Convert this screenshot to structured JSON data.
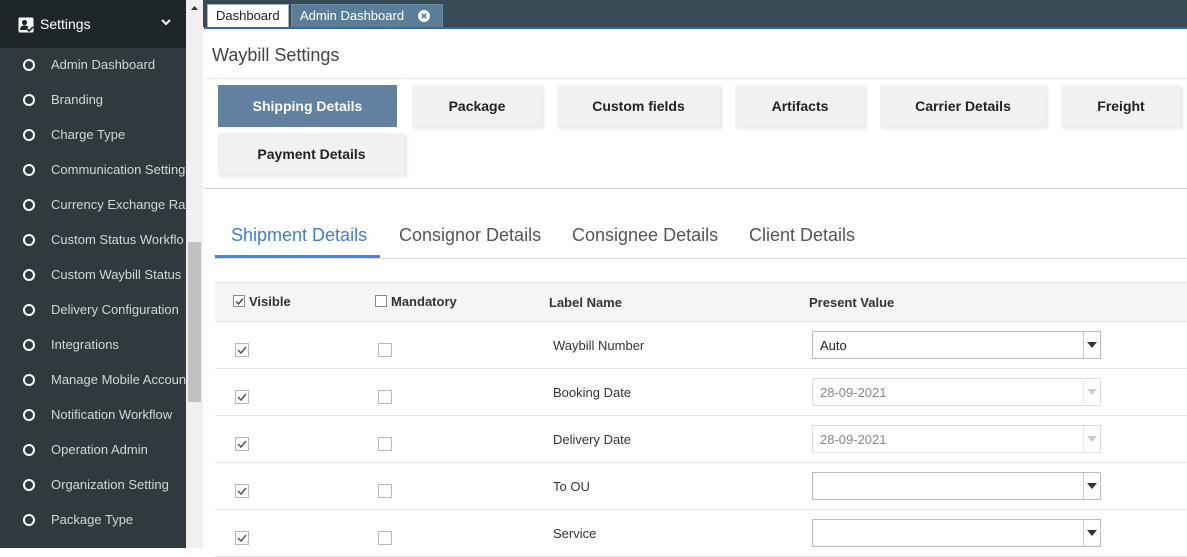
{
  "sidebar": {
    "title": "Settings",
    "items": [
      {
        "label": "Admin Dashboard"
      },
      {
        "label": "Branding"
      },
      {
        "label": "Charge Type"
      },
      {
        "label": "Communication Setting"
      },
      {
        "label": "Currency Exchange Rat"
      },
      {
        "label": "Custom Status Workflo"
      },
      {
        "label": "Custom Waybill Status"
      },
      {
        "label": "Delivery Configuration"
      },
      {
        "label": "Integrations"
      },
      {
        "label": "Manage Mobile Accoun"
      },
      {
        "label": "Notification Workflow"
      },
      {
        "label": "Operation Admin"
      },
      {
        "label": "Organization Setting"
      },
      {
        "label": "Package Type"
      }
    ]
  },
  "tabs": {
    "dashboard": "Dashboard",
    "admin_dashboard": "Admin Dashboard"
  },
  "page": {
    "title": "Waybill Settings"
  },
  "section_tabs": [
    {
      "label": "Shipping Details",
      "active": true
    },
    {
      "label": "Package"
    },
    {
      "label": "Custom fields"
    },
    {
      "label": "Artifacts"
    },
    {
      "label": "Carrier Details"
    },
    {
      "label": "Freight"
    },
    {
      "label": "Payment Details"
    }
  ],
  "sub_tabs": [
    {
      "label": "Shipment Details",
      "active": true
    },
    {
      "label": "Consignor Details"
    },
    {
      "label": "Consignee Details"
    },
    {
      "label": "Client Details"
    }
  ],
  "table": {
    "headers": {
      "visible": "Visible",
      "mandatory": "Mandatory",
      "label_name": "Label Name",
      "present_value": "Present Value"
    },
    "header_visible_checked": true,
    "header_mandatory_checked": false,
    "rows": [
      {
        "label": "Waybill Number",
        "visible": true,
        "mandatory": false,
        "value": "Auto",
        "disabled": false
      },
      {
        "label": "Booking Date",
        "visible": true,
        "mandatory": false,
        "value": "28-09-2021",
        "disabled": true
      },
      {
        "label": "Delivery Date",
        "visible": true,
        "mandatory": false,
        "value": "28-09-2021",
        "disabled": true
      },
      {
        "label": "To OU",
        "visible": true,
        "mandatory": false,
        "value": "",
        "disabled": false
      },
      {
        "label": "Service",
        "visible": true,
        "mandatory": false,
        "value": "",
        "disabled": false
      }
    ]
  },
  "colors": {
    "sidebar_bg": "#2f3a3e",
    "sidebar_header_bg": "#1e2629",
    "tabstrip_bg": "#374a55",
    "active_section_tab": "#62809f",
    "active_sub_tab": "#3f7ed2"
  }
}
